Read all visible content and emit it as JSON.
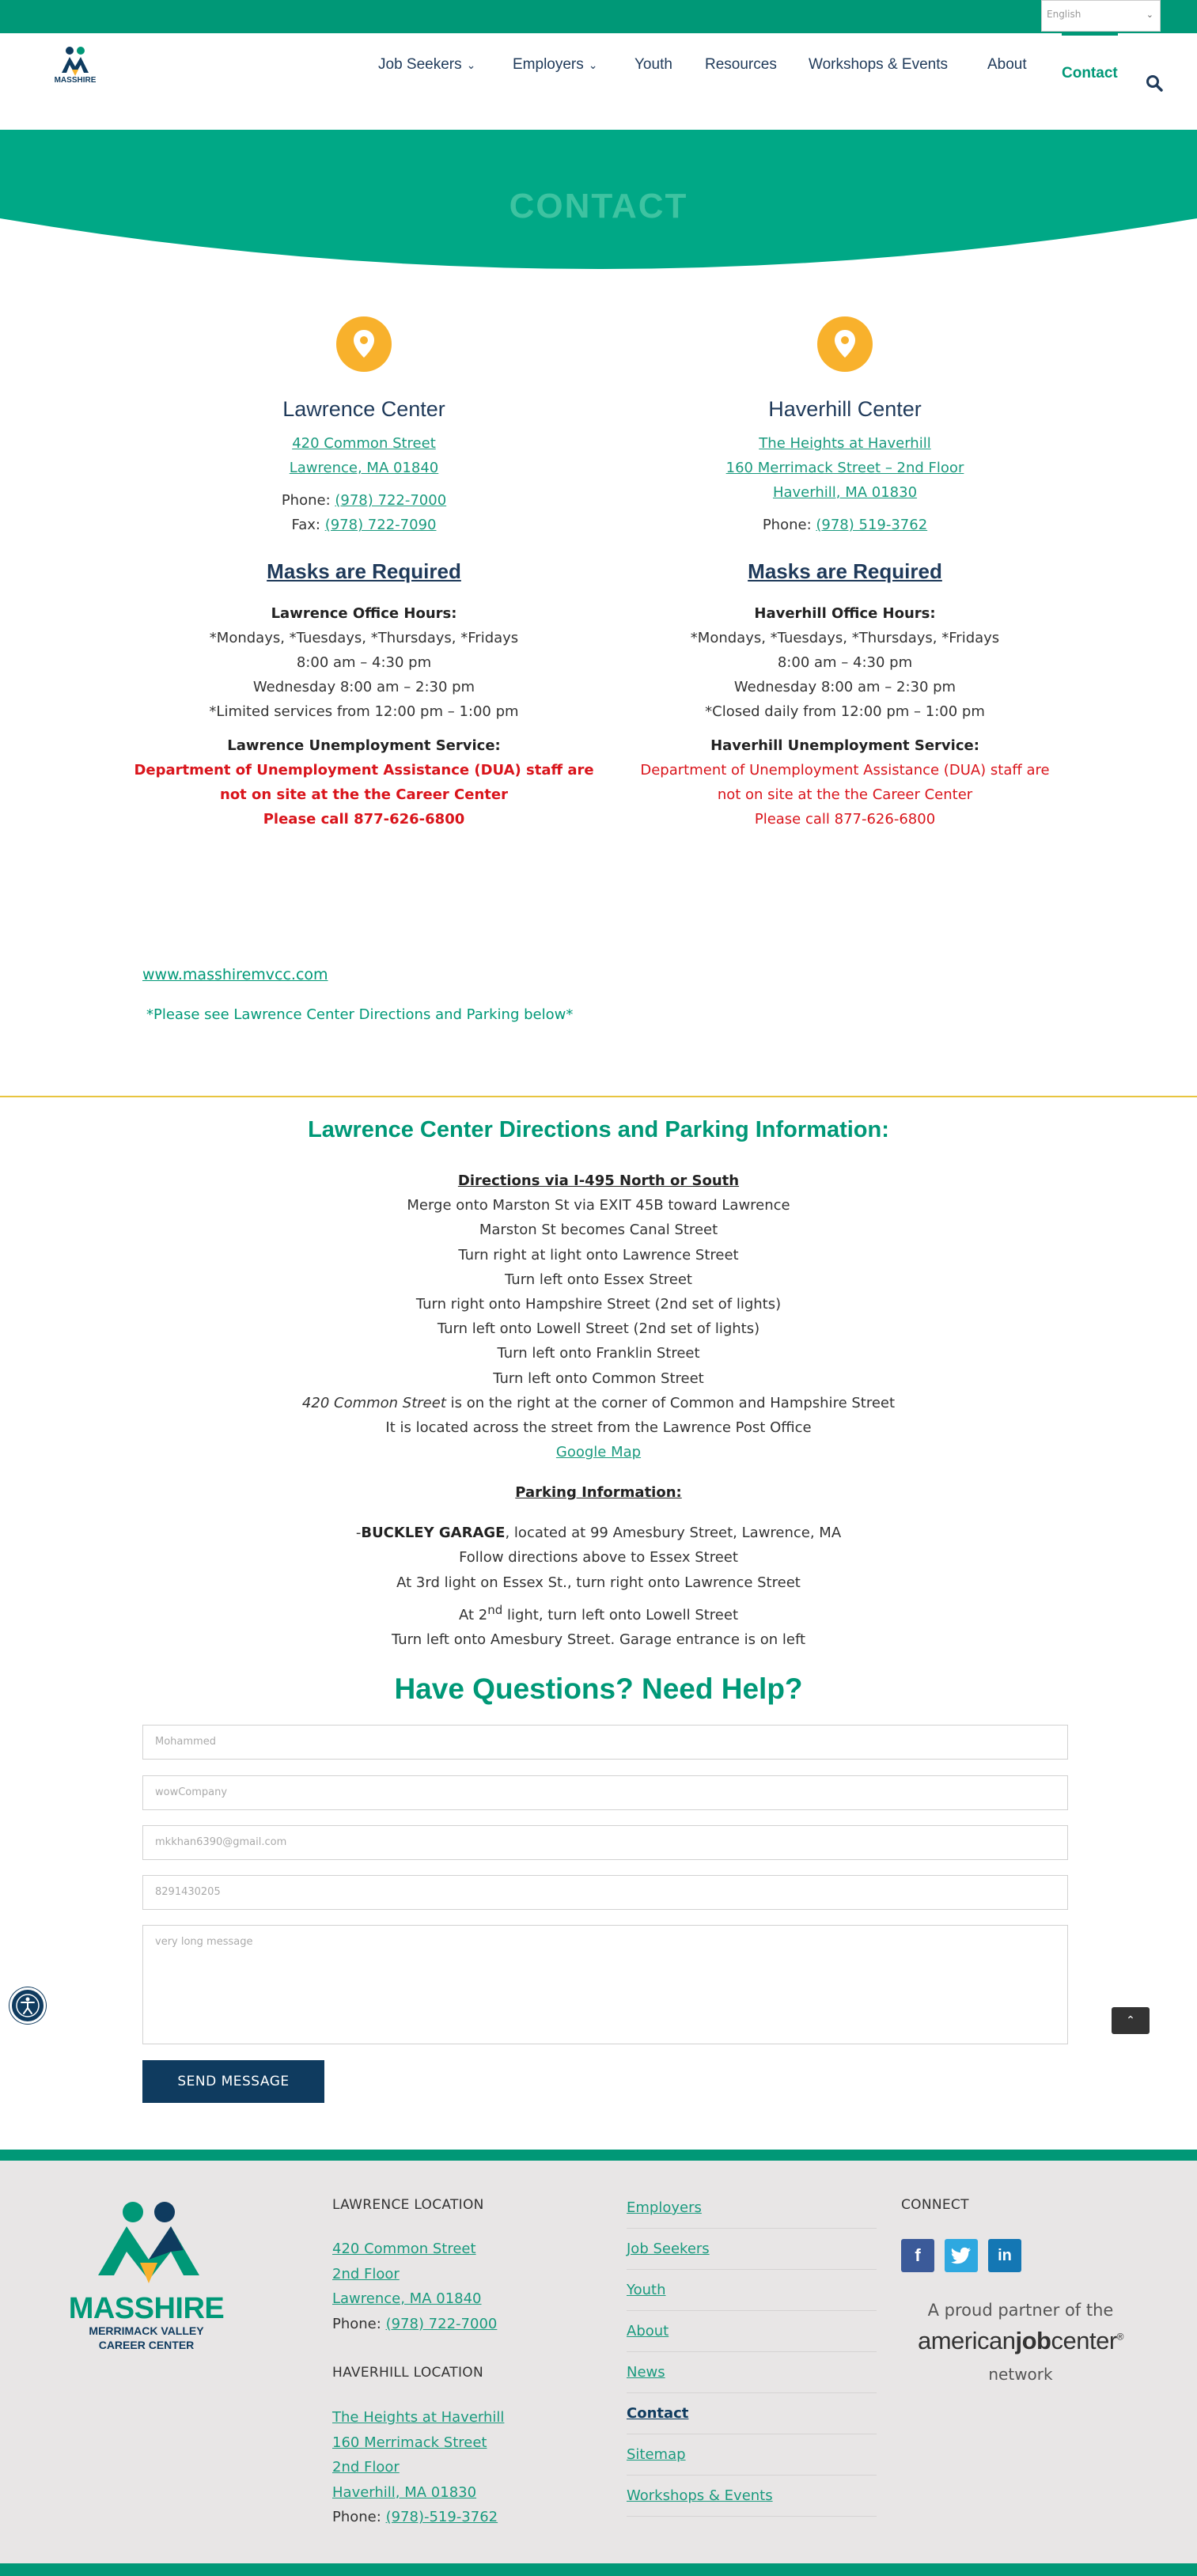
{
  "topbar": {
    "language": "English"
  },
  "header": {
    "logo_text": "MASSHIRE",
    "nav": [
      {
        "label": "Job Seekers",
        "dropdown": true
      },
      {
        "label": "Employers",
        "dropdown": true
      },
      {
        "label": "Youth"
      },
      {
        "label": "Resources"
      },
      {
        "label": "Workshops & Events"
      },
      {
        "label": "About"
      },
      {
        "label": "Contact",
        "active": true
      }
    ]
  },
  "hero": {
    "title": "CONTACT"
  },
  "centers": [
    {
      "name": "Lawrence Center",
      "address": [
        "420 Common Street",
        "Lawrence, MA 01840"
      ],
      "phone_label": "Phone:",
      "phone": "(978) 722-7000",
      "fax_label": "Fax:",
      "fax": "(978) 722-7090",
      "masks": "Masks are Required",
      "hours_heading": "Lawrence Office Hours:",
      "hours": [
        "*Mondays, *Tuesdays, *Thursdays, *Fridays",
        "8:00 am – 4:30 pm",
        "Wednesday 8:00 am – 2:30 pm",
        "*Limited services from 12:00 pm – 1:00 pm"
      ],
      "unemployment_heading": "Lawrence Unemployment Service:",
      "unemployment": [
        "Department of Unemployment Assistance (DUA) staff are",
        "not on site at the the Career Center",
        "Please call 877-626-6800"
      ]
    },
    {
      "name": "Haverhill Center",
      "address": [
        "The Heights at Haverhill",
        "160 Merrimack Street – 2nd Floor",
        "Haverhill, MA 01830"
      ],
      "phone_label": "Phone:",
      "phone": "(978) 519-3762",
      "masks": "Masks are Required",
      "hours_heading": "Haverhill Office Hours:",
      "hours": [
        "*Mondays, *Tuesdays, *Thursdays, *Fridays",
        "8:00 am – 4:30 pm",
        "Wednesday 8:00 am – 2:30 pm",
        "*Closed daily from 12:00 pm – 1:00 pm"
      ],
      "unemployment_heading": "Haverhill Unemployment Service:",
      "unemployment": [
        "Department of Unemployment Assistance (DUA) staff are",
        "not on site at the the Career Center",
        "Please call 877-626-6800"
      ]
    }
  ],
  "website_link": "www.masshiremvcc.com",
  "directions_note": "*Please see Lawrence Center Directions and Parking below*",
  "directions": {
    "title": "Lawrence Center Directions and Parking Information:",
    "heading": "Directions via I-495 North or South",
    "steps": [
      "Merge onto Marston St via EXIT 45B toward Lawrence",
      "Marston St becomes Canal Street",
      "Turn right at light onto Lawrence Street",
      "Turn left onto Essex Street",
      "Turn right onto Hampshire Street (2nd set of lights)",
      "Turn left onto Lowell Street (2nd set of lights)",
      "Turn left onto Franklin Street",
      "Turn left onto Common Street"
    ],
    "corner_italic": "420 Common Street",
    "corner_rest": " is on the right at the corner of Common and Hampshire Street",
    "across": "It is located across the street from the Lawrence Post Office",
    "map_link": "Google Map"
  },
  "parking": {
    "heading": "Parking Information:",
    "dash": "-",
    "garage": "BUCKLEY GARAGE",
    "garage_rest": ", located at 99 Amesbury Street, Lawrence, MA",
    "line2": "Follow directions above to Essex Street",
    "line3": "At 3rd light on Essex St., turn right onto Lawrence Street",
    "line4_a": "At 2",
    "line4_sup": "nd",
    "line4_b": " light, turn left onto Lowell Street",
    "line5": "Turn left onto Amesbury Street. Garage entrance is on left"
  },
  "form": {
    "title": "Have Questions? Need Help?",
    "name_value": "Mohammed",
    "company_value": "wowCompany",
    "email_value": "mkkhan6390@gmail.com",
    "phone_value": "8291430205",
    "message_value": "very long message",
    "submit": "SEND MESSAGE"
  },
  "footer": {
    "logo_line1": "MASSHIRE",
    "logo_line2": "MERRIMACK VALLEY",
    "logo_line3": "CAREER CENTER",
    "lawrence_heading": "LAWRENCE LOCATION",
    "lawrence_lines": [
      "420 Common Street",
      "2nd Floor",
      "Lawrence, MA 01840"
    ],
    "lawrence_phone_label": "Phone:",
    "lawrence_phone": "(978) 722-7000",
    "haverhill_heading": "HAVERHILL LOCATION",
    "haverhill_lines": [
      "The Heights at Haverhill",
      "160 Merrimack Street",
      "2nd Floor",
      "Haverhill, MA 01830"
    ],
    "haverhill_phone_label": "Phone:",
    "haverhill_phone": "(978)-519-3762",
    "nav": [
      "Employers",
      "Job Seekers",
      "Youth",
      "About",
      "News",
      "Contact",
      "Sitemap",
      "Workshops & Events"
    ],
    "connect_heading": "CONNECT",
    "social": [
      "facebook-icon",
      "twitter-icon",
      "linkedin-icon"
    ],
    "partner_line1": "A proud partner of the",
    "partner_brand_a": "american",
    "partner_brand_b": "job",
    "partner_brand_c": "center",
    "partner_line3": "network"
  },
  "colors": {
    "green": "#009877",
    "navy": "#0f3b5f",
    "orange": "#f8b12c",
    "red": "#d9141b",
    "link": "#1a9a7e"
  }
}
